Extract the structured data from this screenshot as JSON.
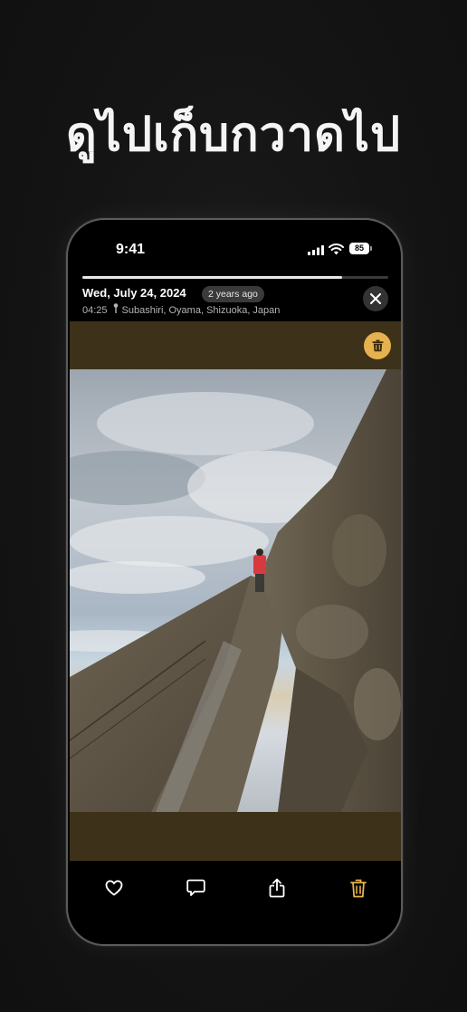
{
  "headline": "ดูไปเก็บกวาดไป",
  "status_bar": {
    "time": "9:41",
    "battery": "85"
  },
  "viewer": {
    "progress": 0.85,
    "date": "Wed, July 24, 2024",
    "relative_time": "2 years ago",
    "time": "04:25",
    "location": "Subashiri, Oyama, Shizuoka, Japan",
    "close_icon": "close-icon",
    "delete_icon": "trash-icon"
  },
  "toolbar": {
    "items": [
      "heart-icon",
      "comment-icon",
      "share-icon",
      "trash-icon"
    ]
  },
  "colors": {
    "background": "#121212",
    "accent": "#e6b24f",
    "media_band": "#3d3219"
  }
}
